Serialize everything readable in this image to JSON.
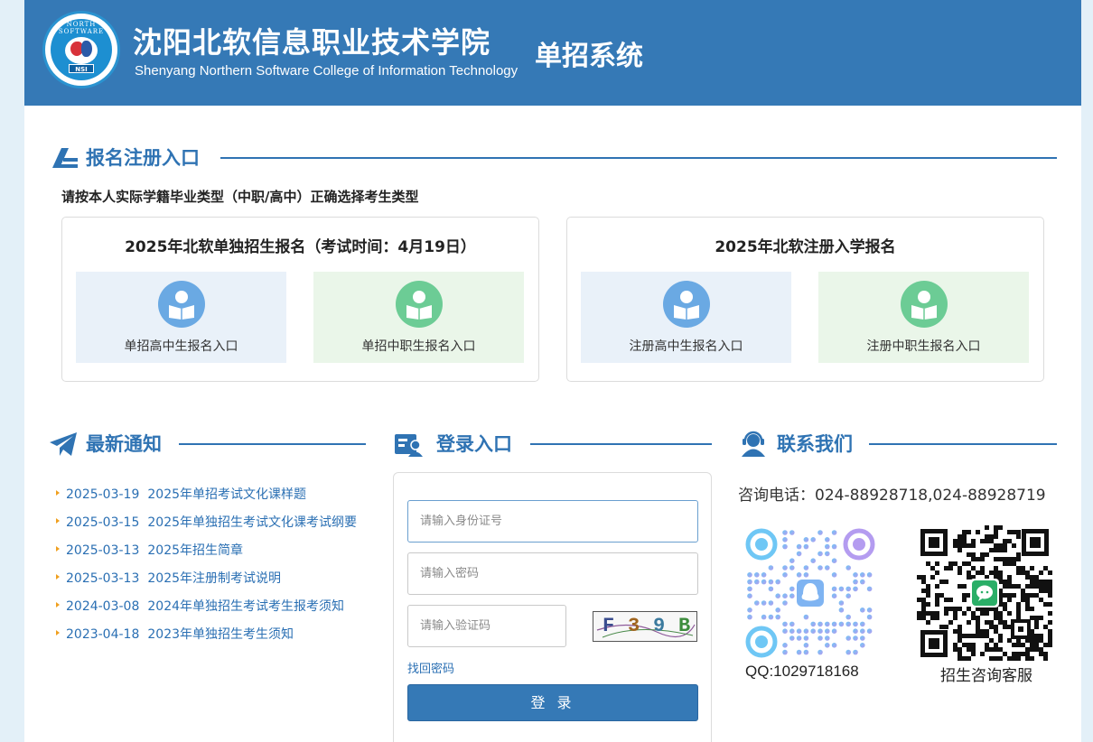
{
  "header": {
    "title_cn": "沈阳北软信息职业技术学院",
    "title_en": "Shenyang Northern Software College of Information Technology",
    "system_name": "单招系统",
    "logo_ring_text": "NORTH SOFTWARE",
    "logo_badge": "NSI"
  },
  "register": {
    "heading": "报名注册入口",
    "hint": "请按本人实际学籍毕业类型（中职/高中）正确选择考生类型",
    "boxes": [
      {
        "title": "2025年北软单独招生报名（考试时间：4月19日）",
        "entries": [
          {
            "label": "单招高中生报名入口"
          },
          {
            "label": "单招中职生报名入口"
          }
        ]
      },
      {
        "title": "2025年北软注册入学报名",
        "entries": [
          {
            "label": "注册高中生报名入口"
          },
          {
            "label": "注册中职生报名入口"
          }
        ]
      }
    ]
  },
  "news": {
    "heading": "最新通知",
    "items": [
      {
        "date": "2025-03-19",
        "title": "2025年单招考试文化课样题"
      },
      {
        "date": "2025-03-15",
        "title": "2025年单独招生考试文化课考试纲要"
      },
      {
        "date": "2025-03-13",
        "title": "2025年招生简章"
      },
      {
        "date": "2025-03-13",
        "title": "2025年注册制考试说明"
      },
      {
        "date": "2024-03-08",
        "title": "2024年单独招生考试考生报考须知"
      },
      {
        "date": "2023-04-18",
        "title": "2023年单独招生考生须知"
      }
    ]
  },
  "login": {
    "heading": "登录入口",
    "id_placeholder": "请输入身份证号",
    "password_placeholder": "请输入密码",
    "captcha_placeholder": "请输入验证码",
    "captcha_text": [
      "F",
      "3",
      "9",
      "B"
    ],
    "forgot": "找回密码",
    "submit": "登 录"
  },
  "contact": {
    "heading": "联系我们",
    "phone": "咨询电话：024-88928718,024-88928719",
    "qq_label": "QQ:1029718168",
    "wechat_label": "招生咨询客服"
  },
  "colors": {
    "brand_blue": "#3579b6",
    "tile_blue": "#e9f1f9",
    "tile_green": "#eaf6e9",
    "icon_blue": "#6aa9e3",
    "icon_green": "#6ccc95",
    "page_bg": "#e3f0f8"
  }
}
